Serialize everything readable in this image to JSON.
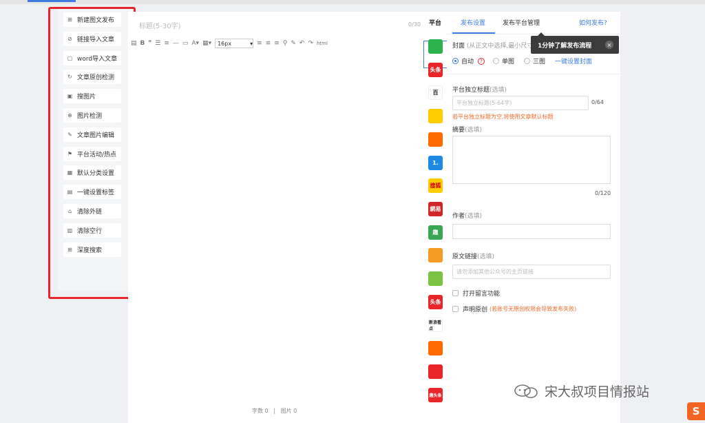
{
  "tools": [
    {
      "label": "新建图文发布",
      "icon": "new-article-icon"
    },
    {
      "label": "链接导入文章",
      "icon": "link-icon"
    },
    {
      "label": "word导入文章",
      "icon": "word-icon"
    },
    {
      "label": "文章原创检测",
      "icon": "refresh-icon"
    },
    {
      "label": "搜图片",
      "icon": "image-icon"
    },
    {
      "label": "图片检测",
      "icon": "search-icon"
    },
    {
      "label": "文章图片编辑",
      "icon": "edit-icon"
    },
    {
      "label": "平台活动/热点",
      "icon": "flag-icon"
    },
    {
      "label": "默认分类设置",
      "icon": "grid-icon"
    },
    {
      "label": "一键设置标签",
      "icon": "tag-icon"
    },
    {
      "label": "清除外链",
      "icon": "unlink-icon"
    },
    {
      "label": "清除空行",
      "icon": "trash-icon"
    },
    {
      "label": "深度搜索",
      "icon": "deep-search-icon"
    }
  ],
  "editor": {
    "title_placeholder": "标题(5-30字)",
    "title_count": "0/30",
    "font_size": "16px",
    "word_count": "字数 0",
    "image_count": "图片 0",
    "footer_sep": "|"
  },
  "platforms": {
    "label": "平台",
    "items": [
      {
        "name": "wechat",
        "text": "",
        "color": "#2bb24c"
      },
      {
        "name": "toutiao",
        "text": "头条",
        "color": "#e8262a"
      },
      {
        "name": "baijia",
        "text": "百",
        "color": "#ffffff"
      },
      {
        "name": "qq",
        "text": "",
        "color": "#ffcc00"
      },
      {
        "name": "dayu",
        "text": "",
        "color": "#ff6a00"
      },
      {
        "name": "yidian",
        "text": "1.",
        "color": "#1e88e5"
      },
      {
        "name": "sohu",
        "text": "搜狐",
        "color": "#ffcc00"
      },
      {
        "name": "wangyi",
        "text": "網易",
        "color": "#d0262a"
      },
      {
        "name": "qutoutiao",
        "text": "趣",
        "color": "#3aa655"
      },
      {
        "name": "weibo",
        "text": "",
        "color": "#f59a23"
      },
      {
        "name": "xigua",
        "text": "",
        "color": "#7cc243"
      },
      {
        "name": "toutiao2",
        "text": "头条",
        "color": "#e8262a"
      },
      {
        "name": "xinlang",
        "text": "新浪看点",
        "color": "#ffffff"
      },
      {
        "name": "meipai",
        "text": "",
        "color": "#ff6a00"
      },
      {
        "name": "fenghuang",
        "text": "",
        "color": "#e8262a"
      },
      {
        "name": "qutou2",
        "text": "趣头条",
        "color": "#e8262a"
      }
    ]
  },
  "settings": {
    "tab_publish": "发布设置",
    "tab_platform_manage": "发布平台管理",
    "how_to_publish": "如何发布?",
    "cover_label": "封面",
    "cover_hint": "(从正文中选择,最小尺寸4",
    "cover_auto": "自动",
    "cover_single": "单图",
    "cover_triple": "三图",
    "cover_oneclick": "一键设置封面",
    "platform_title_label": "平台独立标题",
    "optional": "(选填)",
    "platform_title_placeholder": "平台独立标题(5-64字)",
    "platform_title_count": "0/64",
    "platform_title_warning": "若平台独立标题为空,将使用文章默认标题",
    "summary_label": "摘要",
    "summary_count": "0/120",
    "author_label": "作者",
    "source_label": "原文链接",
    "source_placeholder": "请勿添加其他公众号的主页链接",
    "comment_label": "打开留言功能",
    "original_label": "声明原创",
    "original_warning": "(若账号无原创权限会导致发布失败)"
  },
  "tooltip": {
    "text": "1分钟了解发布流程",
    "close": "×"
  },
  "watermark": {
    "text": "宋大叔项目情报站"
  },
  "sogou_logo": "S"
}
